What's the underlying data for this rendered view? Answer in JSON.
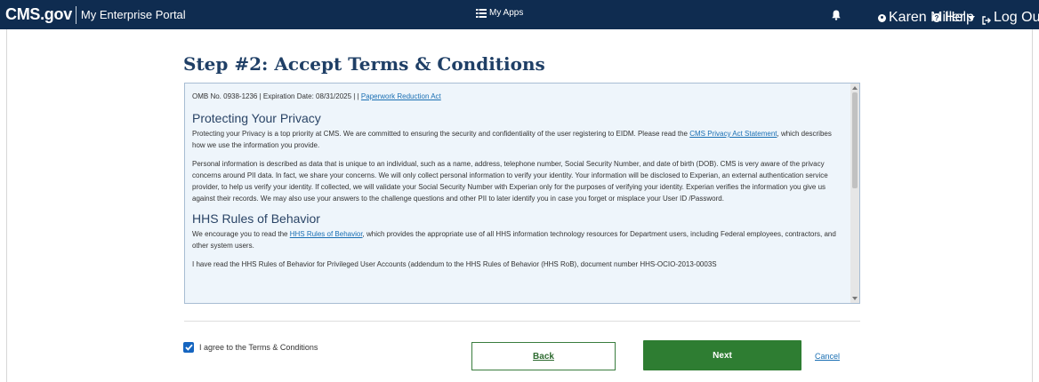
{
  "header": {
    "brand_logo": "CMS.gov",
    "brand_portal": "My Enterprise Portal",
    "my_apps_label": "My Apps",
    "user_name": "Karen Miller",
    "help_label": "Help",
    "logout_label": "Log Out"
  },
  "page": {
    "title": "Step #2: Accept Terms & Conditions"
  },
  "terms": {
    "omb_text": "OMB No. 0938-1236 | Expiration Date: 08/31/2025 | |",
    "omb_link": "Paperwork Reduction Act",
    "section1_heading": "Protecting Your Privacy",
    "section1_p1_before": "Protecting your Privacy is a top priority at CMS. We are committed to ensuring the security and confidentiality of the user registering to EIDM. Please read the",
    "section1_p1_link": "CMS Privacy Act Statement",
    "section1_p1_after": ", which describes how we use the information you provide.",
    "section1_p2": "Personal information is described as data that is unique to an individual, such as a name, address, telephone number, Social Security Number, and date of birth (DOB). CMS is very aware of the privacy concerns around PII data. In fact, we share your concerns. We will only collect personal information to verify your identity. Your information will be disclosed to Experian, an external authentication service provider, to help us verify your identity. If collected, we will validate your Social Security Number with Experian only for the purposes of verifying your identity. Experian verifies the information you give us against their records. We may also use your answers to the challenge questions and other PII to later identify you in case you forget or misplace your User ID /Password.",
    "section2_heading": "HHS Rules of Behavior",
    "section2_p1_before": "We encourage you to read the",
    "section2_p1_link": "HHS Rules of Behavior",
    "section2_p1_after": ", which provides the appropriate use of all HHS information technology resources for Department users, including Federal employees, contractors, and other system users.",
    "section2_p2_cut": "I have read the HHS Rules of Behavior for Privileged User Accounts (addendum to the HHS Rules of Behavior (HHS RoB), document number HHS-OCIO-2013-0003S"
  },
  "form": {
    "agree_label": "I agree to the Terms & Conditions",
    "agree_checked": true,
    "back_label": "Back",
    "next_label": "Next",
    "cancel_label": "Cancel"
  },
  "colors": {
    "header_bg": "#0f2c50",
    "title": "#1f3f66",
    "next_button": "#2e7d32",
    "link": "#1a6fb3",
    "terms_bg": "#eef5fb"
  },
  "icons": [
    "list-icon",
    "bell-icon",
    "user-icon",
    "chevron-down-icon",
    "help-icon",
    "logout-icon",
    "check-icon"
  ]
}
